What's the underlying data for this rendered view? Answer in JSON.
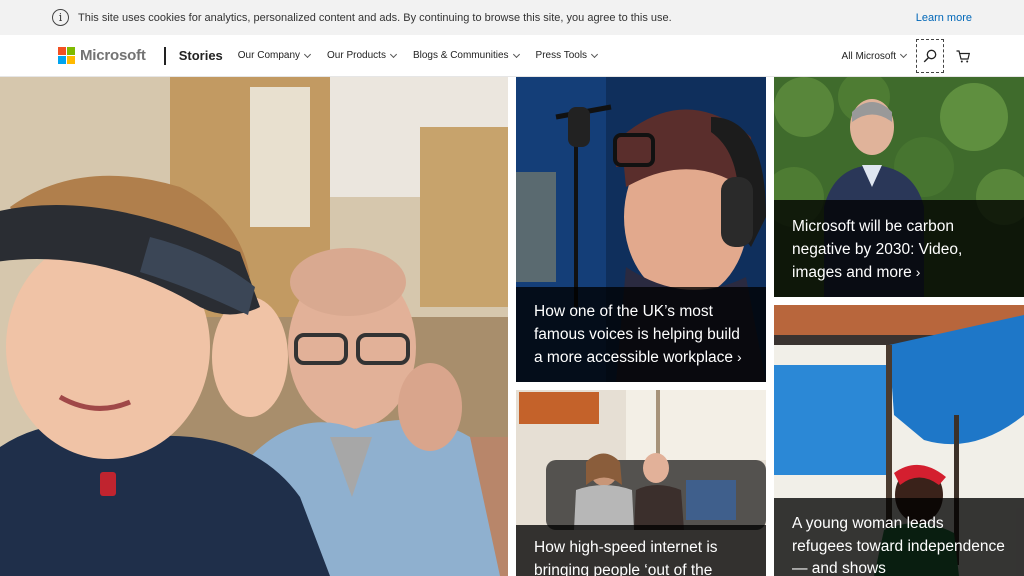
{
  "cookie_bar": {
    "message": "This site uses cookies for analytics, personalized content and ads. By continuing to browse this site, you agree to this use.",
    "learn_more": "Learn more"
  },
  "header": {
    "brand": "Microsoft",
    "section": "Stories",
    "nav": [
      {
        "label": "Our Company"
      },
      {
        "label": "Our Products"
      },
      {
        "label": "Blogs & Communities"
      },
      {
        "label": "Press Tools"
      }
    ],
    "all_microsoft": "All Microsoft",
    "logo_colors": [
      "#f25022",
      "#7fba00",
      "#00a4ef",
      "#ffb900"
    ]
  },
  "tiles": {
    "hero": {
      "caption": ""
    },
    "accessible": {
      "caption": "How one of the UK’s most famous voices is helping build a more accessible workplace",
      "arrow": "›"
    },
    "carbon": {
      "caption": "Microsoft will be carbon negative by 2030: Video, images and more",
      "arrow": "›"
    },
    "internet": {
      "caption": "How high-speed internet is bringing people ‘out of the"
    },
    "refugees": {
      "caption": "A young woman leads refugees toward independence — and shows"
    }
  }
}
